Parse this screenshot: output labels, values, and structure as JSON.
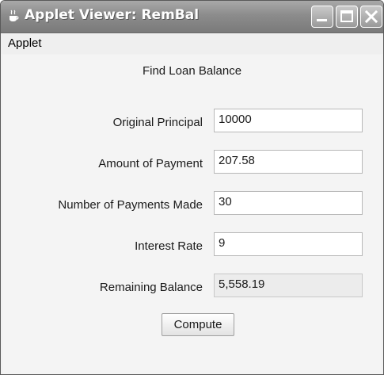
{
  "window": {
    "title": "Applet Viewer: RemBal"
  },
  "menubar": {
    "items": [
      {
        "label": "Applet"
      }
    ]
  },
  "form": {
    "heading": "Find Loan Balance",
    "principal": {
      "label": "Original Principal",
      "value": "10000"
    },
    "payment": {
      "label": "Amount of Payment",
      "value": "207.58"
    },
    "num_payments": {
      "label": "Number of Payments Made",
      "value": "30"
    },
    "rate": {
      "label": "Interest Rate",
      "value": "9"
    },
    "balance": {
      "label": "Remaining Balance",
      "value": "5,558.19"
    },
    "compute_label": "Compute"
  },
  "icons": {
    "title": "java-coffee-icon",
    "minimize": "minimize-icon",
    "maximize": "maximize-icon",
    "close": "close-icon"
  }
}
